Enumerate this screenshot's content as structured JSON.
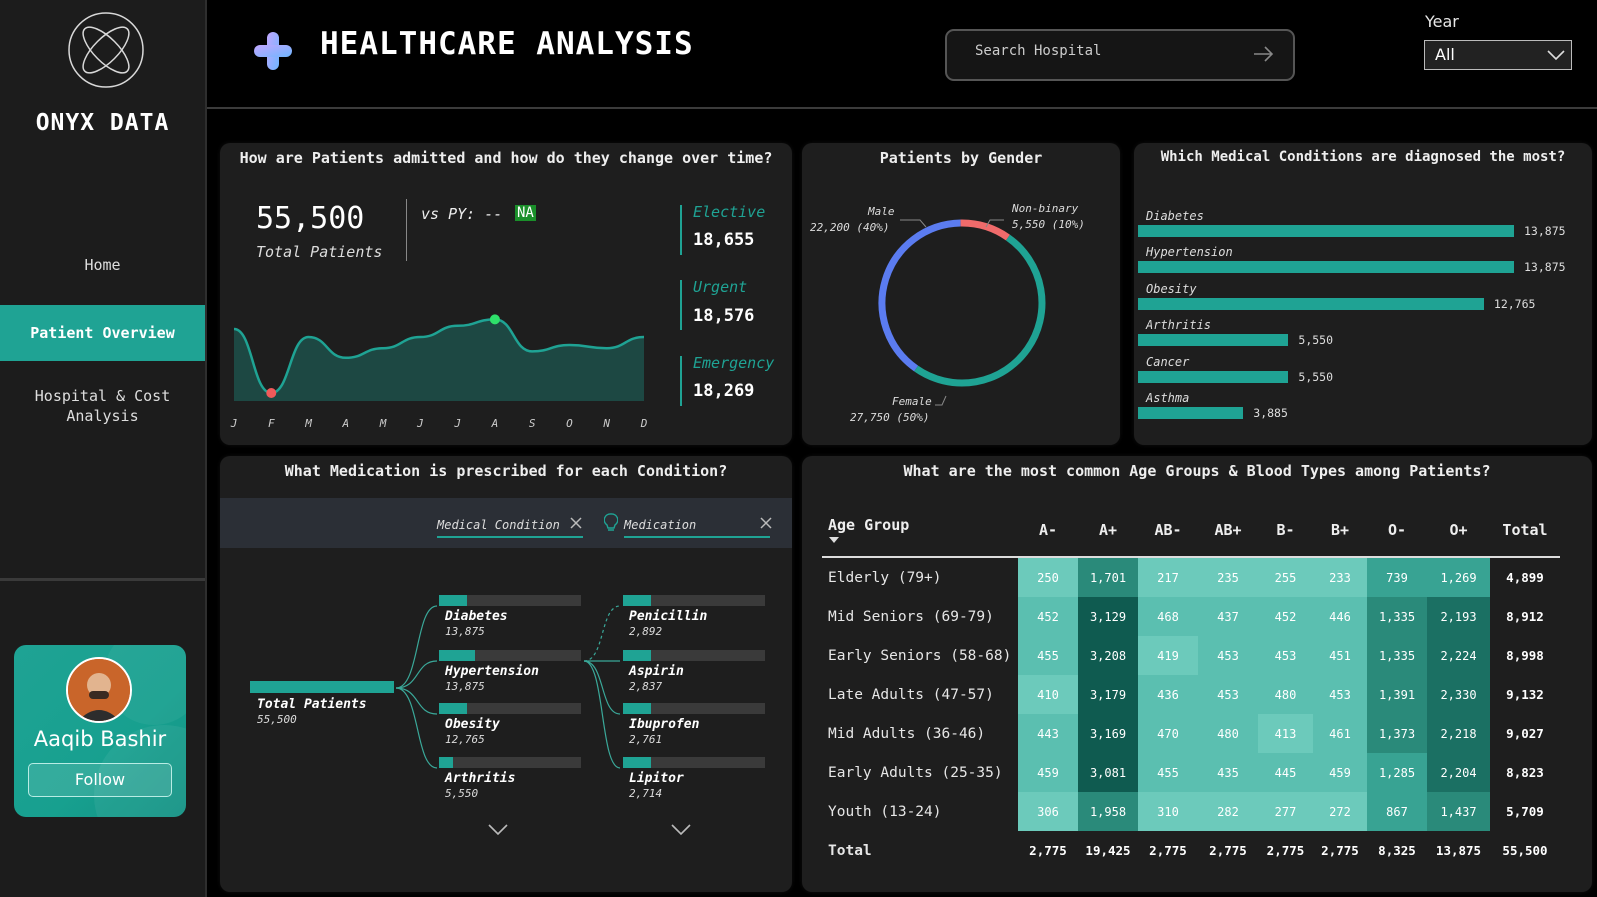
{
  "brand": {
    "name": "ONYX DATA"
  },
  "nav": {
    "home": "Home",
    "patient_overview": "Patient Overview",
    "hospital_line1": "Hospital & Cost",
    "hospital_line2": "Analysis"
  },
  "profile": {
    "name": "Aaqib Bashir",
    "follow_label": "Follow"
  },
  "header": {
    "title": "HEALTHCARE ANALYSIS",
    "search_placeholder": "Search Hospital",
    "year_label": "Year",
    "year_value": "All"
  },
  "admissions": {
    "title": "How are Patients admitted and how do they change over time?",
    "total_value": "55,500",
    "total_label": "Total Patients",
    "vs_py_label": "vs PY: --",
    "vs_py_badge": "NA",
    "types": [
      {
        "label": "Elective",
        "value": "18,655"
      },
      {
        "label": "Urgent",
        "value": "18,576"
      },
      {
        "label": "Emergency",
        "value": "18,269"
      }
    ]
  },
  "gender": {
    "title": "Patients by Gender",
    "male_label": "Male",
    "male_value": "22,200 (40%)",
    "nonbinary_label": "Non-binary",
    "nonbinary_value": "5,550 (10%)",
    "female_label": "Female",
    "female_value": "27,750 (50%)",
    "colors": {
      "male": "#5b7cf0",
      "nonbinary": "#f06b6b",
      "female": "#1fa394"
    }
  },
  "conditions": {
    "title": "Which Medical Conditions are diagnosed the most?",
    "items": [
      {
        "label": "Diabetes",
        "value": "13,875"
      },
      {
        "label": "Hypertension",
        "value": "13,875"
      },
      {
        "label": "Obesity",
        "value": "12,765"
      },
      {
        "label": "Arthritis",
        "value": "5,550"
      },
      {
        "label": "Cancer",
        "value": "5,550"
      },
      {
        "label": "Asthma",
        "value": "3,885"
      }
    ]
  },
  "medication": {
    "title": "What Medication is prescribed for each Condition?",
    "filter_condition": "Medical Condition",
    "filter_medication": "Medication",
    "root_label": "Total Patients",
    "root_value": "55,500",
    "conditions": [
      {
        "label": "Diabetes",
        "value": "13,875",
        "fill": 0.2
      },
      {
        "label": "Hypertension",
        "value": "13,875",
        "fill": 0.25
      },
      {
        "label": "Obesity",
        "value": "12,765",
        "fill": 0.2
      },
      {
        "label": "Arthritis",
        "value": "5,550",
        "fill": 0.1
      }
    ],
    "medications": [
      {
        "label": "Penicillin",
        "value": "2,892",
        "fill": 0.2
      },
      {
        "label": "Aspirin",
        "value": "2,837",
        "fill": 0.2
      },
      {
        "label": "Ibuprofen",
        "value": "2,761",
        "fill": 0.2
      },
      {
        "label": "Lipitor",
        "value": "2,714",
        "fill": 0.2
      }
    ]
  },
  "age_blood": {
    "title": "What are the most common Age Groups & Blood Types among Patients?",
    "headers": [
      "Age Group",
      "A-",
      "A+",
      "AB-",
      "AB+",
      "B-",
      "B+",
      "O-",
      "O+",
      "Total"
    ],
    "rows": [
      {
        "group": "Elderly (79+)",
        "values": [
          "250",
          "1,701",
          "217",
          "235",
          "255",
          "233",
          "739",
          "1,269"
        ],
        "total": "4,899"
      },
      {
        "group": "Mid Seniors (69-79)",
        "values": [
          "452",
          "3,129",
          "468",
          "437",
          "452",
          "446",
          "1,335",
          "2,193"
        ],
        "total": "8,912"
      },
      {
        "group": "Early Seniors (58-68)",
        "values": [
          "455",
          "3,208",
          "419",
          "453",
          "453",
          "451",
          "1,335",
          "2,224"
        ],
        "total": "8,998"
      },
      {
        "group": "Late Adults (47-57)",
        "values": [
          "410",
          "3,179",
          "436",
          "453",
          "480",
          "453",
          "1,391",
          "2,330"
        ],
        "total": "9,132"
      },
      {
        "group": "Mid Adults (36-46)",
        "values": [
          "443",
          "3,169",
          "470",
          "480",
          "413",
          "461",
          "1,373",
          "2,218"
        ],
        "total": "9,027"
      },
      {
        "group": "Early Adults (25-35)",
        "values": [
          "459",
          "3,081",
          "455",
          "435",
          "445",
          "459",
          "1,285",
          "2,204"
        ],
        "total": "8,823"
      },
      {
        "group": "Youth (13-24)",
        "values": [
          "306",
          "1,958",
          "310",
          "282",
          "277",
          "272",
          "867",
          "1,437"
        ],
        "total": "5,709"
      }
    ],
    "totals": {
      "label": "Total",
      "values": [
        "2,775",
        "19,425",
        "2,775",
        "2,775",
        "2,775",
        "2,775",
        "8,325",
        "13,875"
      ],
      "total": "55,500"
    }
  },
  "chart_data": [
    {
      "type": "area",
      "categories": [
        "J",
        "F",
        "M",
        "A",
        "M",
        "J",
        "J",
        "A",
        "S",
        "O",
        "N",
        "D"
      ],
      "values": [
        4700,
        4300,
        4650,
        4520,
        4580,
        4650,
        4720,
        4760,
        4560,
        4600,
        4580,
        4650
      ],
      "title": "How are Patients admitted and how do they change over time?",
      "max_point": "A",
      "min_point": "F"
    },
    {
      "type": "pie",
      "title": "Patients by Gender",
      "categories": [
        "Female",
        "Male",
        "Non-binary"
      ],
      "values": [
        27750,
        22200,
        5550
      ]
    },
    {
      "type": "bar",
      "title": "Which Medical Conditions are diagnosed the most?",
      "categories": [
        "Diabetes",
        "Hypertension",
        "Obesity",
        "Arthritis",
        "Cancer",
        "Asthma"
      ],
      "values": [
        13875,
        13875,
        12765,
        5550,
        5550,
        3885
      ]
    }
  ]
}
